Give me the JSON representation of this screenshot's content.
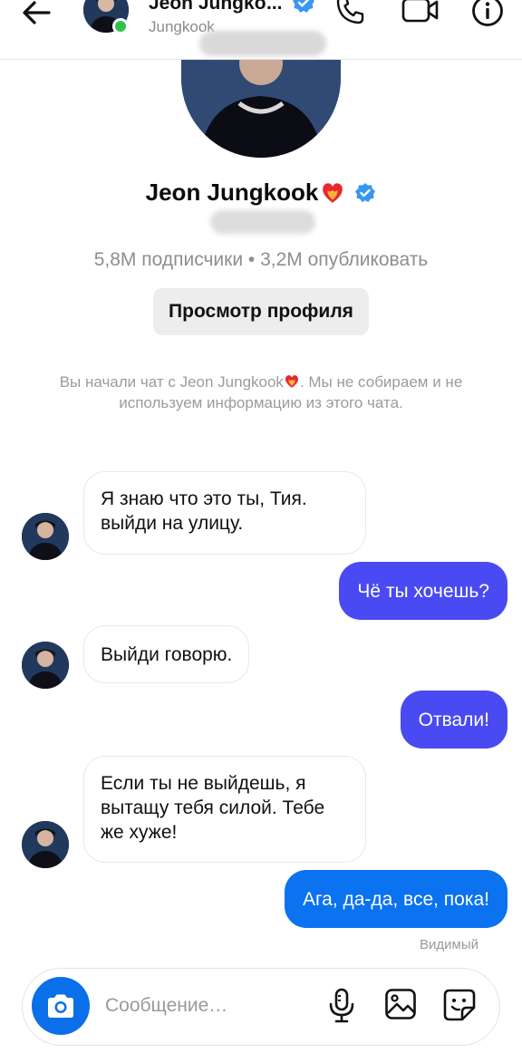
{
  "header": {
    "name": "Jeon Jungko",
    "name_ellipsis": "...",
    "username": "Jungkook",
    "icons": [
      "back-arrow-icon",
      "verified-icon",
      "phone-icon",
      "video-icon",
      "info-icon"
    ]
  },
  "profile": {
    "name": "Jeon Jungkook",
    "stats": "5,8M подписчики • 3,2M опубликовать",
    "view_button": "Просмотр профиля",
    "info_line1": "Вы начали чат с Jeon Jungkook",
    "info_line1_suffix": ". Мы не собираем и не",
    "info_line2": "используем информацию из этого чата."
  },
  "messages": [
    {
      "from": "them",
      "line1": "Я знаю что это ты, Тия.",
      "line2": "выйди на улицу."
    },
    {
      "from": "me",
      "text": "Чё ты хочешь?"
    },
    {
      "from": "them",
      "text": "Выйди говорю."
    },
    {
      "from": "me",
      "text": "Отвали!"
    },
    {
      "from": "them",
      "line1": "Если ты не выйдешь, я",
      "line2": "вытащу тебя силой. Тебе",
      "line3": "же хуже!"
    },
    {
      "from": "me",
      "text": "Ага, да-да, все, пока!"
    }
  ],
  "seen_label": "Видимый",
  "composer": {
    "placeholder": "Сообщение…",
    "icons": [
      "camera-icon",
      "microphone-icon",
      "gallery-icon",
      "sticker-icon"
    ]
  },
  "colors": {
    "accent_blue": "#0b72f0",
    "bubble_purple": "#4a4af2",
    "online_green": "#2ec24a",
    "verified_blue": "#3897f0"
  }
}
